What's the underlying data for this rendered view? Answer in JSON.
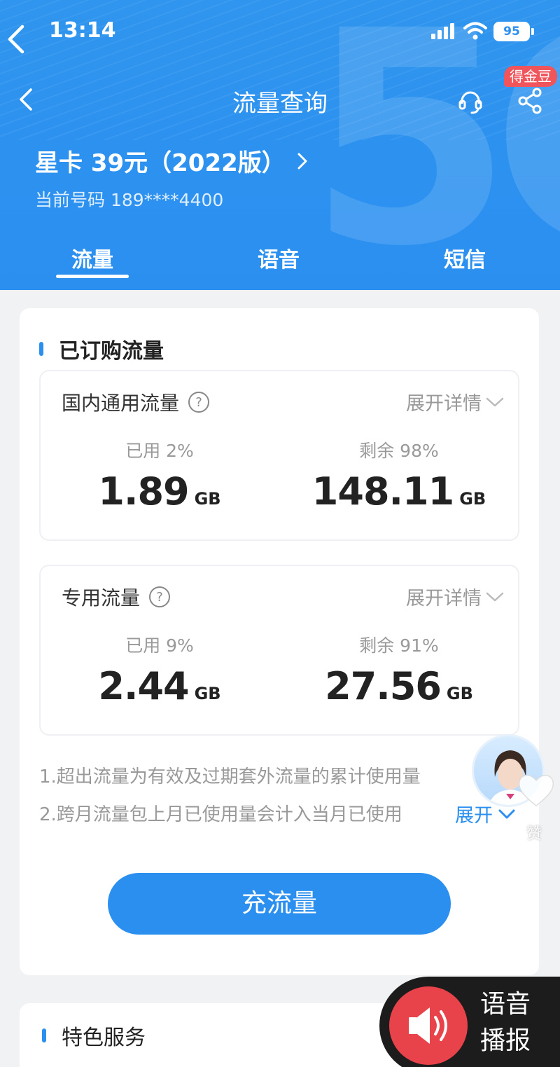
{
  "status_bar": {
    "time": "13:14",
    "battery": "95"
  },
  "nav": {
    "title": "流量查询",
    "badge": "得金豆"
  },
  "plan": {
    "name": "星卡 39元（2022版）",
    "current_number": "当前号码 189****4400"
  },
  "tabs": [
    {
      "label": "流量",
      "active": true
    },
    {
      "label": "语音",
      "active": false
    },
    {
      "label": "短信",
      "active": false
    }
  ],
  "subscribed": {
    "title": "已订购流量",
    "domestic": {
      "title": "国内通用流量",
      "expand": "展开详情",
      "used_label": "已用 2%",
      "used_value": "1.89",
      "used_unit": "GB",
      "remain_label": "剩余 98%",
      "remain_value": "148.11",
      "remain_unit": "GB"
    },
    "dedicated": {
      "title": "专用流量",
      "expand": "展开详情",
      "used_label": "已用 9%",
      "used_value": "2.44",
      "used_unit": "GB",
      "remain_label": "剩余 91%",
      "remain_value": "27.56",
      "remain_unit": "GB"
    },
    "notes": [
      "1.超出流量为有效及过期套外流量的累计使用量",
      "2.跨月流量包上月已使用量会计入当月已使用"
    ],
    "notes_expand": "展开",
    "recharge_button": "充流量"
  },
  "featured": {
    "title": "特色服务"
  },
  "like_label": "赞",
  "voice_broadcast": {
    "line1": "语音",
    "line2": "播报"
  },
  "colors": {
    "brand_blue": "#2b8ff0",
    "badge_red": "#f0555c",
    "voice_red": "#e8434a"
  }
}
